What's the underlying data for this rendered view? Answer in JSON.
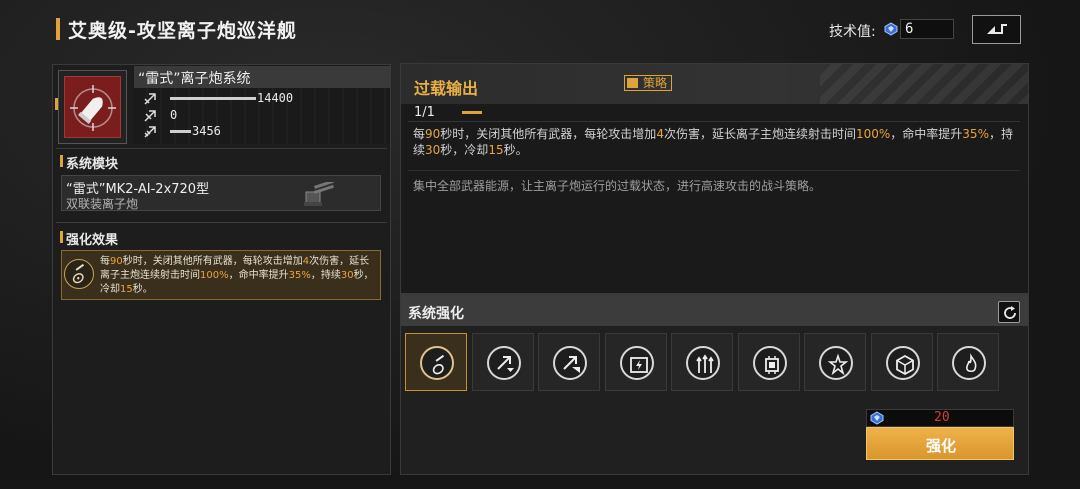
{
  "header": {
    "title": "艾奥级-攻坚离子炮巡洋舰",
    "tech_label": "技术值:",
    "tech_value": "6"
  },
  "system": {
    "name": "“雷式”离子炮系统",
    "stats": [
      {
        "icon": "attack-stat-icon",
        "value": "14400",
        "bar_fraction": 1.0
      },
      {
        "icon": "range-stat-icon",
        "value": "0",
        "bar_fraction": 0.0
      },
      {
        "icon": "speed-stat-icon",
        "value": "3456",
        "bar_fraction": 0.24
      }
    ]
  },
  "module": {
    "section_title": "系统模块",
    "name": "“雷式”MK2-AI-2x720型",
    "subtitle": "双联装离子炮"
  },
  "effect": {
    "section_title": "强化效果",
    "text_parts": [
      {
        "t": "每",
        "hl": false
      },
      {
        "t": "90",
        "hl": true
      },
      {
        "t": "秒时，关闭其他所有武器，每轮攻击增加",
        "hl": false
      },
      {
        "t": "4",
        "hl": true
      },
      {
        "t": "次伤害，延长离子主炮连续射击时间",
        "hl": false
      },
      {
        "t": "100%",
        "hl": true
      },
      {
        "t": "，命中率提升",
        "hl": false
      },
      {
        "t": "35%",
        "hl": true
      },
      {
        "t": "，持续",
        "hl": false
      },
      {
        "t": "30",
        "hl": true
      },
      {
        "t": "秒，冷却",
        "hl": false
      },
      {
        "t": "15",
        "hl": true
      },
      {
        "t": "秒。",
        "hl": false
      }
    ]
  },
  "detail": {
    "title": "过载输出",
    "strategy_label": "策略",
    "level": "1/1",
    "desc_parts": [
      {
        "t": "每",
        "hl": false
      },
      {
        "t": "90",
        "hl": true
      },
      {
        "t": "秒时，关闭其他所有武器，每轮攻击增加",
        "hl": false
      },
      {
        "t": "4",
        "hl": true
      },
      {
        "t": "次伤害，延长离子主炮连续射击时间",
        "hl": false
      },
      {
        "t": "100%",
        "hl": true
      },
      {
        "t": "，命中率提升",
        "hl": false
      },
      {
        "t": "35%",
        "hl": true
      },
      {
        "t": "，持续",
        "hl": false
      },
      {
        "t": "30",
        "hl": true
      },
      {
        "t": "秒，冷却",
        "hl": false
      },
      {
        "t": "15",
        "hl": true
      },
      {
        "t": "秒。",
        "hl": false
      }
    ],
    "flavor": "集中全部武器能源，让主离子炮运行的过载状态，进行高速攻击的战斗策略。"
  },
  "enhance": {
    "title": "系统强化",
    "selected_index": 0,
    "slots": [
      "overload-guitar-icon",
      "damage-up-icon",
      "damage-up-alt-icon",
      "power-cell-icon",
      "triple-arrow-up-icon",
      "chip-icon",
      "burst-icon",
      "armor-cube-icon",
      "flame-badge-icon"
    ],
    "cost": "20",
    "button_label": "强化"
  },
  "colors": {
    "accent": "#e0a33a",
    "cost_insufficient": "#d63b3b",
    "icon_bg": "#7b1d1d"
  }
}
